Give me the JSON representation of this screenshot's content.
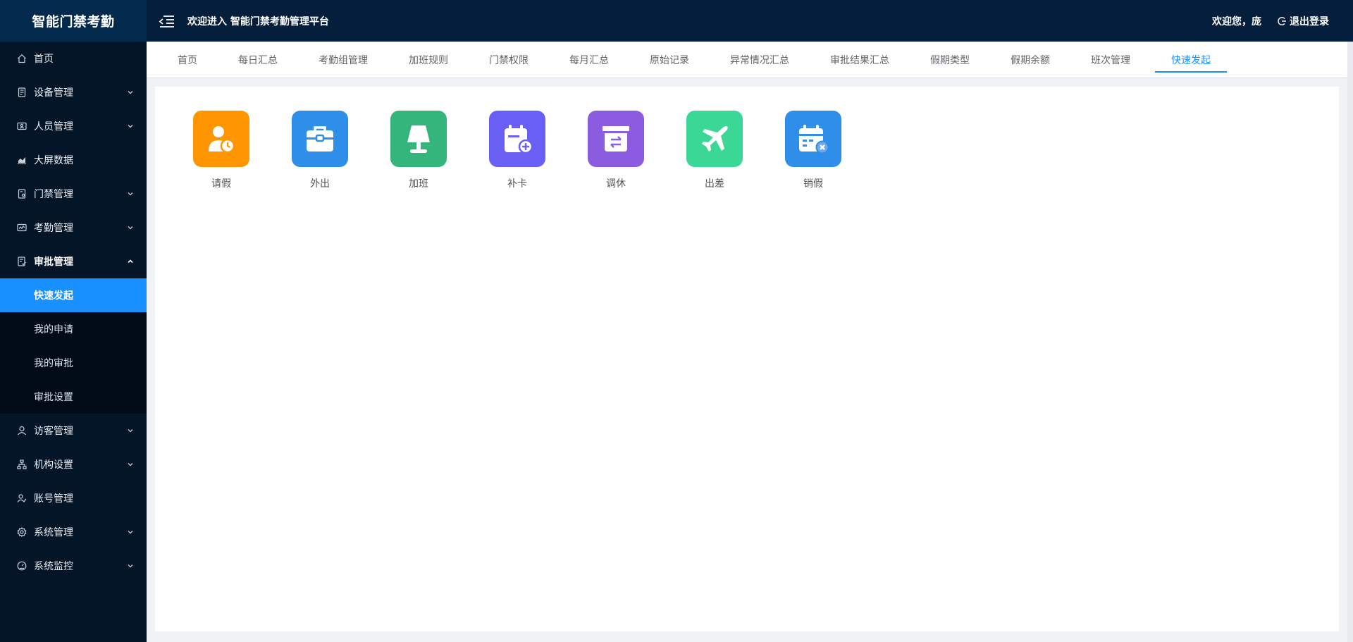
{
  "sidebar": {
    "logo": "智能门禁考勤",
    "items": [
      {
        "label": "首页",
        "icon": "home-icon",
        "has_arrow": false
      },
      {
        "label": "设备管理",
        "icon": "device-icon",
        "has_arrow": true
      },
      {
        "label": "人员管理",
        "icon": "person-card-icon",
        "has_arrow": true
      },
      {
        "label": "大屏数据",
        "icon": "chart-icon",
        "has_arrow": false
      },
      {
        "label": "门禁管理",
        "icon": "door-icon",
        "has_arrow": true
      },
      {
        "label": "考勤管理",
        "icon": "attendance-icon",
        "has_arrow": true
      },
      {
        "label": "审批管理",
        "icon": "approval-icon",
        "has_arrow": true,
        "open": true,
        "children": [
          {
            "label": "快速发起",
            "active": true
          },
          {
            "label": "我的申请"
          },
          {
            "label": "我的审批"
          },
          {
            "label": "审批设置"
          }
        ]
      },
      {
        "label": "访客管理",
        "icon": "user-icon",
        "has_arrow": true
      },
      {
        "label": "机构设置",
        "icon": "org-tree-icon",
        "has_arrow": true
      },
      {
        "label": "账号管理",
        "icon": "account-icon",
        "has_arrow": false
      },
      {
        "label": "系统管理",
        "icon": "gear-icon",
        "has_arrow": true
      },
      {
        "label": "系统监控",
        "icon": "gauge-icon",
        "has_arrow": true
      }
    ]
  },
  "header": {
    "title": "欢迎进入 智能门禁考勤管理平台",
    "welcome": "欢迎您，庞",
    "logout": "退出登录"
  },
  "tabs": [
    {
      "label": "首页"
    },
    {
      "label": "每日汇总"
    },
    {
      "label": "考勤组管理"
    },
    {
      "label": "加班规则"
    },
    {
      "label": "门禁权限"
    },
    {
      "label": "每月汇总"
    },
    {
      "label": "原始记录"
    },
    {
      "label": "异常情况汇总"
    },
    {
      "label": "审批结果汇总"
    },
    {
      "label": "假期类型"
    },
    {
      "label": "假期余额"
    },
    {
      "label": "班次管理"
    },
    {
      "label": "快速发起",
      "active": true
    }
  ],
  "apps": [
    {
      "label": "请假",
      "icon": "leave-icon",
      "color": "#ff9500"
    },
    {
      "label": "外出",
      "icon": "briefcase-icon",
      "color": "#2f8ee8"
    },
    {
      "label": "加班",
      "icon": "lamp-icon",
      "color": "#34b57c"
    },
    {
      "label": "补卡",
      "icon": "calendar-add-icon",
      "color": "#6a5ff5"
    },
    {
      "label": "调休",
      "icon": "swap-box-icon",
      "color": "#8b5ce0"
    },
    {
      "label": "出差",
      "icon": "airplane-icon",
      "color": "#3bd796"
    },
    {
      "label": "销假",
      "icon": "calendar-cancel-icon",
      "color": "#2f8ee8"
    }
  ]
}
